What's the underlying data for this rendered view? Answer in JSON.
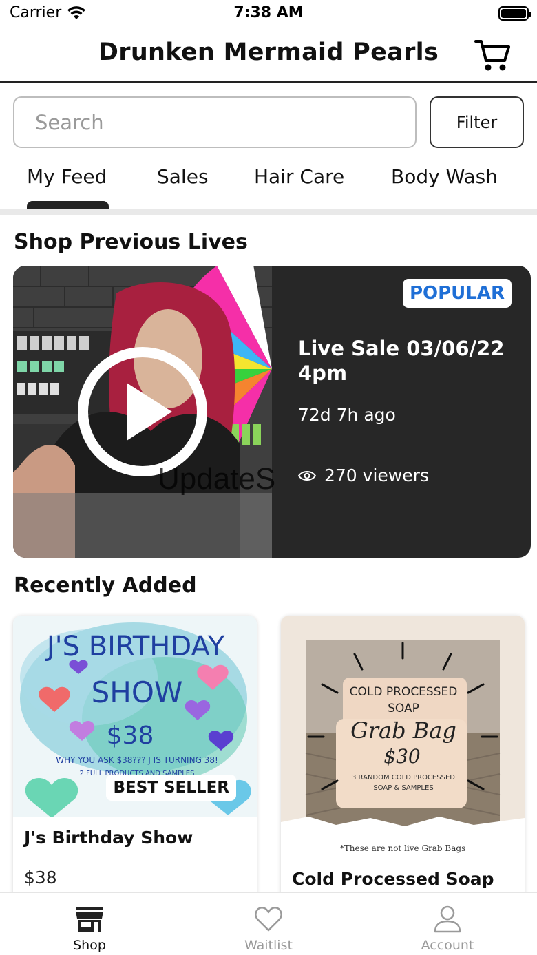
{
  "status_bar": {
    "carrier": "Carrier",
    "time": "7:38 AM"
  },
  "header": {
    "title": "Drunken Mermaid Pearls",
    "cart_icon": "cart-icon"
  },
  "search": {
    "placeholder": "Search",
    "filter_label": "Filter"
  },
  "tabs": [
    {
      "label": "My Feed",
      "active": true
    },
    {
      "label": "Sales"
    },
    {
      "label": "Hair Care"
    },
    {
      "label": "Body Wash"
    }
  ],
  "previous_lives": {
    "heading": "Shop Previous Lives",
    "card": {
      "badge": "POPULAR",
      "title": "Live Sale 03/06/22 4pm",
      "ago": "72d 7h ago",
      "viewers": "270 viewers",
      "watermark": "UpdateS",
      "thumb_wheel_colors": [
        "#f52fa8",
        "#3db6f5",
        "#f5e52f",
        "#37d13d",
        "#f5842f",
        "#ffffff"
      ]
    }
  },
  "recently_added": {
    "heading": "Recently Added",
    "products": [
      {
        "name": "J's Birthday Show",
        "price": "$38",
        "badge": "BEST SELLER",
        "art": {
          "line1": "J'S BIRTHDAY",
          "line2": "SHOW",
          "price": "$38",
          "sub1": "WHY YOU ASK $38??? J IS TURNING 38!",
          "sub2": "2 FULL PRODUCTS AND SAMPLES"
        }
      },
      {
        "name": "Cold Processed Soap",
        "price": "",
        "art": {
          "line1": "COLD PROCESSED",
          "line2": "SOAP",
          "line3": "Grab Bag",
          "price": "$30",
          "sub1": "3 RANDOM COLD PROCESSED",
          "sub2": "SOAP & SAMPLES",
          "footnote": "*These are not live Grab Bags"
        }
      }
    ]
  },
  "tab_bar": [
    {
      "label": "Shop",
      "icon": "storefront-icon",
      "active": true
    },
    {
      "label": "Waitlist",
      "icon": "heart-icon"
    },
    {
      "label": "Account",
      "icon": "person-icon"
    }
  ],
  "colors": {
    "accent_blue": "#1f6fd6",
    "dark_card": "#272727",
    "active_tab": "#222222"
  }
}
